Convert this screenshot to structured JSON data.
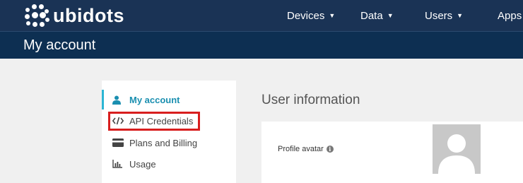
{
  "brand": {
    "name": "ubidots",
    "logo_icon": "dots-logo-icon"
  },
  "nav": [
    {
      "label": "Devices",
      "has_caret": true
    },
    {
      "label": "Data",
      "has_caret": true
    },
    {
      "label": "Users",
      "has_caret": true
    },
    {
      "label": "Apps",
      "has_caret": false
    }
  ],
  "page": {
    "title": "My account"
  },
  "sidebar": {
    "items": [
      {
        "label": "My account",
        "icon": "user-icon",
        "active": true
      },
      {
        "label": "API Credentials",
        "icon": "code-icon",
        "active": false,
        "highlighted": true
      },
      {
        "label": "Plans and Billing",
        "icon": "credit-card-icon",
        "active": false
      },
      {
        "label": "Usage",
        "icon": "bar-chart-icon",
        "active": false
      }
    ]
  },
  "main": {
    "section_title": "User information",
    "profile_avatar_label": "Profile avatar",
    "info_icon_glyph": "i"
  },
  "colors": {
    "topbar": "#1a3355",
    "subbar": "#0d2f52",
    "active_accent": "#2cb5d4",
    "highlight_border": "#d81e1e"
  }
}
